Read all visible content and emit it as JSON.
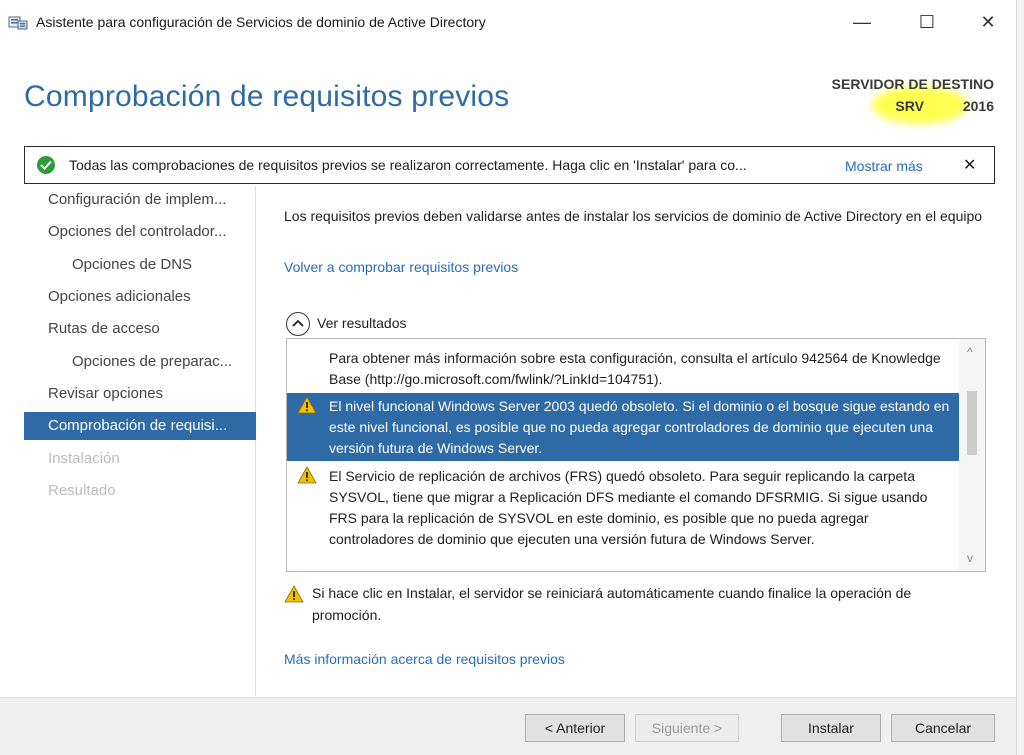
{
  "window": {
    "title": "Asistente para configuración de Servicios de dominio de Active Directory",
    "controls": {
      "minimize": "—",
      "maximize": "☐",
      "close": "✕"
    }
  },
  "header": {
    "page_title": "Comprobación de requisitos previos",
    "dest_label": "SERVIDOR DE DESTINO",
    "dest_server": "SRV          2016"
  },
  "notice": {
    "text": "Todas las comprobaciones de requisitos previos se realizaron correctamente. Haga clic en 'Instalar' para co...",
    "more_link": "Mostrar más",
    "close": "✕"
  },
  "sidebar": {
    "items": [
      {
        "label": "Configuración de implem...",
        "state": "normal"
      },
      {
        "label": "Opciones del controlador...",
        "state": "normal"
      },
      {
        "label": "Opciones de DNS",
        "state": "normal"
      },
      {
        "label": "Opciones adicionales",
        "state": "normal"
      },
      {
        "label": "Rutas de acceso",
        "state": "normal"
      },
      {
        "label": "Opciones de preparac...",
        "state": "normal"
      },
      {
        "label": "Revisar opciones",
        "state": "normal"
      },
      {
        "label": "Comprobación de requisi...",
        "state": "active"
      },
      {
        "label": "Instalación",
        "state": "disabled"
      },
      {
        "label": "Resultado",
        "state": "disabled"
      }
    ]
  },
  "main": {
    "intro": "Los requisitos previos deben validarse antes de instalar los servicios de dominio de Active Directory en el equipo",
    "recheck_link": "Volver a comprobar requisitos previos",
    "results_label": "Ver resultados",
    "results": [
      {
        "text": "Para obtener más información sobre esta configuración, consulta el artículo 942564 de Knowledge Base (http://go.microsoft.com/fwlink/?LinkId=104751).",
        "warning": false
      },
      {
        "text": "El nivel funcional Windows Server 2003 quedó obsoleto. Si el dominio o el bosque sigue estando en este nivel funcional, es posible que no pueda agregar controladores de dominio que ejecuten una versión futura de Windows Server.",
        "warning": true
      },
      {
        "text": "El Servicio de replicación de archivos (FRS) quedó obsoleto. Para seguir replicando la carpeta SYSVOL, tiene que migrar a Replicación DFS mediante el comando DFSRMIG. Si sigue usando FRS para la replicación de SYSVOL en este dominio, es posible que no pueda agregar controladores de dominio que ejecuten una versión futura de Windows Server.",
        "warning": true
      }
    ],
    "scroll_up": "^",
    "scroll_down": "v",
    "restart_note": "Si hace clic en Instalar, el servidor se reiniciará automáticamente cuando finalice la operación de promoción.",
    "more_info_link": "Más información acerca de requisitos previos"
  },
  "footer": {
    "prev": "< Anterior",
    "next": "Siguiente >",
    "install": "Instalar",
    "cancel": "Cancelar"
  },
  "colors": {
    "accent": "#2e6aa5",
    "link": "#2a6cb8",
    "success": "#2f9a3b",
    "warning": "#f2c200"
  }
}
